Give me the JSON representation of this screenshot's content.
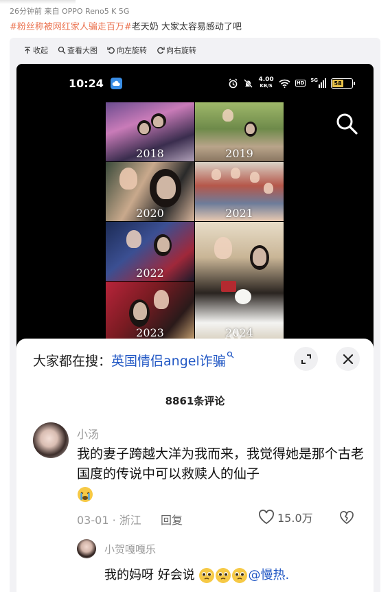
{
  "post": {
    "meta": "26分钟前  来自 OPPO Reno5 K 5G",
    "tag": "#粉丝称被网红家人骗走百万#",
    "text": "老天奶 大家太容易感动了吧"
  },
  "toolbar": {
    "collapse": "收起",
    "view_large": "查看大图",
    "rotate_left": "向左旋转",
    "rotate_right": "向右旋转"
  },
  "phone_status": {
    "time": "10:24",
    "speed_value": "4.00",
    "speed_unit": "KB/S",
    "hd": "HD",
    "network": "5G",
    "battery": "58"
  },
  "collage_years": [
    "2018",
    "2019",
    "2020",
    "2021",
    "2022",
    "2024",
    "2023"
  ],
  "watermark": "...fun",
  "sheet": {
    "search_prefix": "大家都在搜：",
    "search_keyword": "英国情侣angel诈骗",
    "comment_count": "8861条评论"
  },
  "comments": [
    {
      "user": "小汤",
      "text": "我的妻子跨越大洋为我而来，我觉得她是那个古老国度的传说中可以救赎人的仙子",
      "emoji": "crying-face",
      "date_location": "03-01 · 浙江",
      "reply_label": "回复",
      "likes": "15.0万",
      "reply": {
        "user": "小贺嘎嘎乐",
        "text": "我的妈呀 好会说",
        "mention": "@慢热."
      }
    }
  ],
  "colors": {
    "tag": "#eb7350",
    "link": "#2157c4",
    "battery": "#e8c24a"
  }
}
